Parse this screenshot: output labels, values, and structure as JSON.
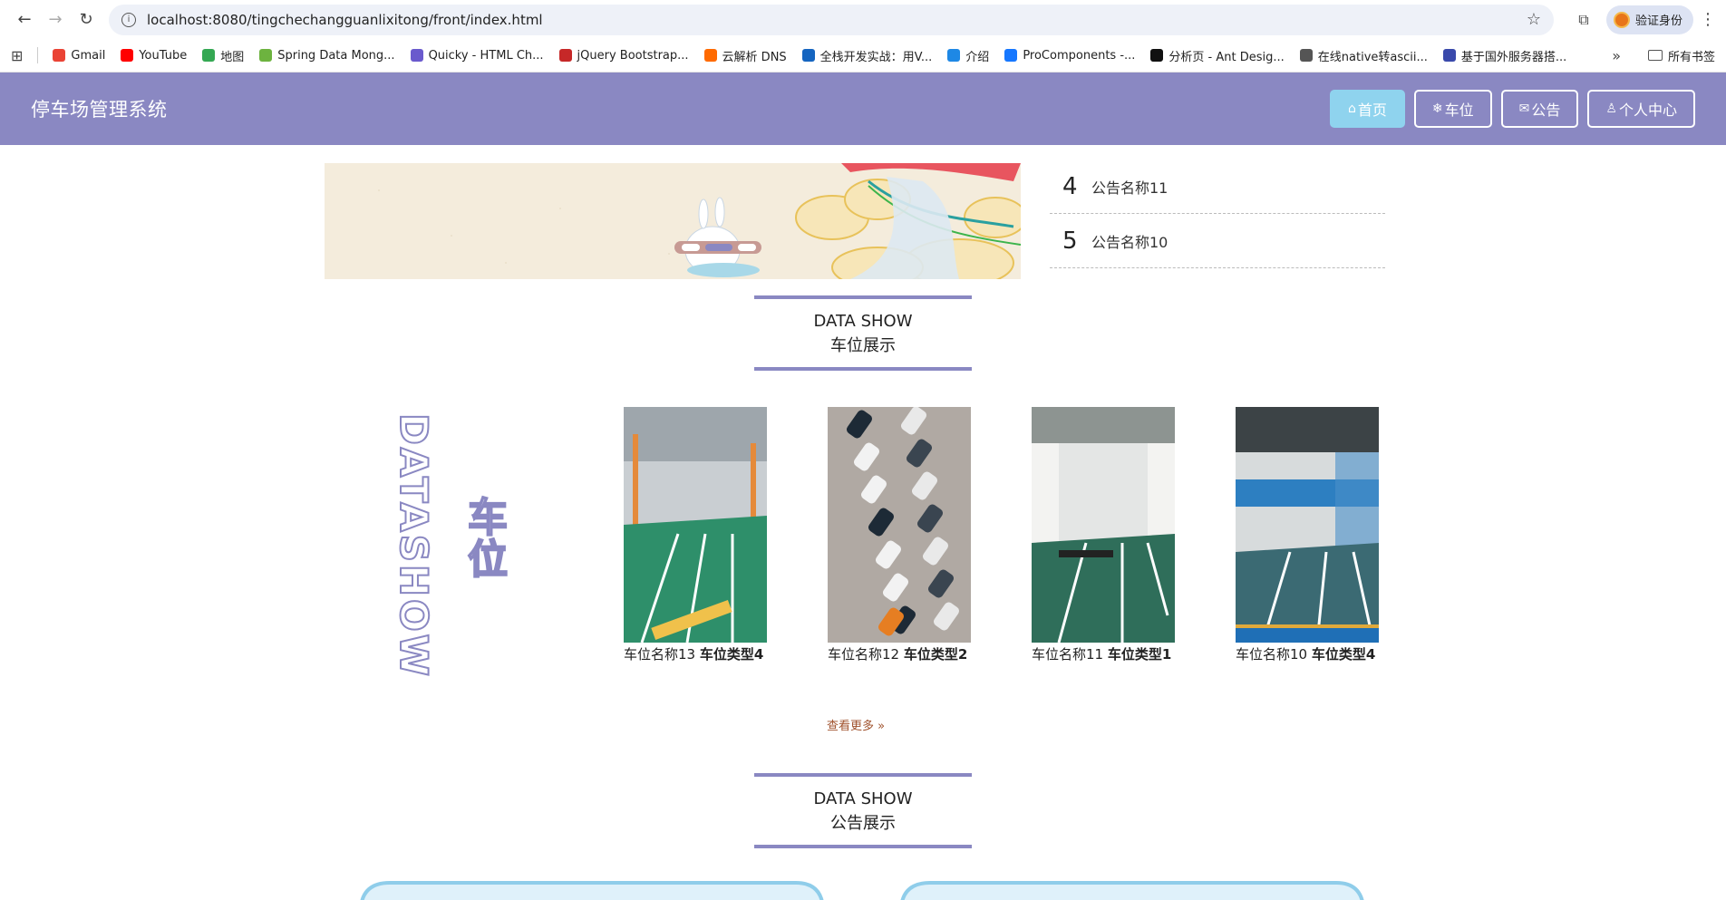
{
  "browser": {
    "url": "localhost:8080/tingchechangguanlixitong/front/index.html",
    "profile_label": "验证身份",
    "bookmarks": [
      {
        "label": "Gmail",
        "color": "#ea4335"
      },
      {
        "label": "YouTube",
        "color": "#ff0000"
      },
      {
        "label": "地图",
        "color": "#34a853"
      },
      {
        "label": "Spring Data Mong...",
        "color": "#6db33f"
      },
      {
        "label": "Quicky - HTML Ch...",
        "color": "#6a5acd"
      },
      {
        "label": "jQuery Bootstrap...",
        "color": "#c62828"
      },
      {
        "label": "云解析 DNS",
        "color": "#ff6a00"
      },
      {
        "label": "全栈开发实战：用V...",
        "color": "#1565c0"
      },
      {
        "label": "介绍",
        "color": "#1e88e5"
      },
      {
        "label": "ProComponents -...",
        "color": "#1677ff"
      },
      {
        "label": "分析页 - Ant Desig...",
        "color": "#111111"
      },
      {
        "label": "在线native转ascii...",
        "color": "#555555"
      },
      {
        "label": "基于国外服务器搭...",
        "color": "#3949ab"
      }
    ],
    "all_bookmarks_label": "所有书签"
  },
  "site": {
    "title": "停车场管理系统",
    "nav": [
      {
        "label": "首页",
        "icon": "home-icon",
        "active": true
      },
      {
        "label": "车位",
        "icon": "snowflake-icon",
        "active": false
      },
      {
        "label": "公告",
        "icon": "mail-icon",
        "active": false
      },
      {
        "label": "个人中心",
        "icon": "user-icon",
        "active": false
      }
    ]
  },
  "notices": [
    {
      "num": "4",
      "title": "公告名称11"
    },
    {
      "num": "5",
      "title": "公告名称10"
    }
  ],
  "section_parking": {
    "en": "DATA SHOW",
    "zh": "车位展示"
  },
  "side_deco": {
    "en": "DATASHOW",
    "zh": "车位"
  },
  "cards": [
    {
      "name": "车位名称13",
      "type": "车位类型4"
    },
    {
      "name": "车位名称12",
      "type": "车位类型2"
    },
    {
      "name": "车位名称11",
      "type": "车位类型1"
    },
    {
      "name": "车位名称10",
      "type": "车位类型4"
    }
  ],
  "more_label": "查看更多",
  "section_notice": {
    "en": "DATA SHOW",
    "zh": "公告展示"
  },
  "colors": {
    "primary": "#8a88c2",
    "active_nav": "#8fd3ee",
    "link": "#a0522d"
  }
}
